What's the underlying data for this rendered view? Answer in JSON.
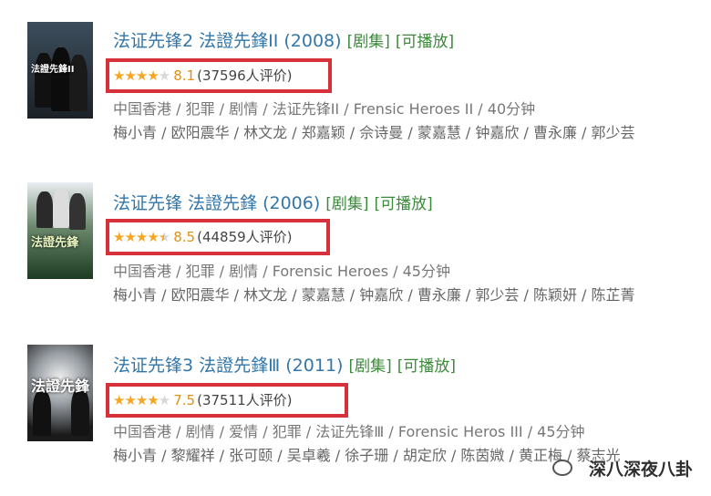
{
  "items": [
    {
      "title": "法证先锋2 法證先鋒II (2008)",
      "tags": [
        "[剧集]",
        "[可播放]"
      ],
      "stars_filled": 4,
      "score": "8.1",
      "count": "(37596人评价)",
      "meta": "中国香港 / 犯罪 / 剧情 / 法证先锋II / Frensic Heroes II / 40分钟",
      "cast": "梅小青 / 欧阳震华 / 林文龙 / 郑嘉颖 / 佘诗曼 / 蒙嘉慧 / 钟嘉欣 / 曹永廉 / 郭少芸",
      "poster_text": "法證先鋒II"
    },
    {
      "title": "法证先锋 法證先鋒 (2006)",
      "tags": [
        "[剧集]",
        "[可播放]"
      ],
      "stars_filled": 4.5,
      "score": "8.5",
      "count": "(44859人评价)",
      "meta": "中国香港 / 犯罪 / 剧情 / Forensic Heroes / 45分钟",
      "cast": "梅小青 / 欧阳震华 / 林文龙 / 蒙嘉慧 / 钟嘉欣 / 曹永廉 / 郭少芸 / 陈颖妍 / 陈芷菁",
      "poster_text": "法證先鋒"
    },
    {
      "title": "法证先锋3 法證先鋒Ⅲ (2011)",
      "tags": [
        "[剧集]",
        "[可播放]"
      ],
      "stars_filled": 4,
      "score": "7.5",
      "count": "(37511人评价)",
      "meta": "中国香港 / 剧情 / 爱情 / 犯罪 / 法证先锋Ⅲ / Forensic Heros III / 45分钟",
      "cast": "梅小青 / 黎耀祥 / 张可颐 / 吴卓羲 / 徐子珊 / 胡定欣 / 陈茵媺 / 黄正梅 / 蔡志光",
      "poster_text": "法證先鋒"
    }
  ],
  "watermark": "深八深夜八卦",
  "colors": {
    "title": "#3377aa",
    "tag": "#3a8a3a",
    "star": "#f5a623",
    "score": "#e09015",
    "highlight_box": "#d6303a"
  }
}
